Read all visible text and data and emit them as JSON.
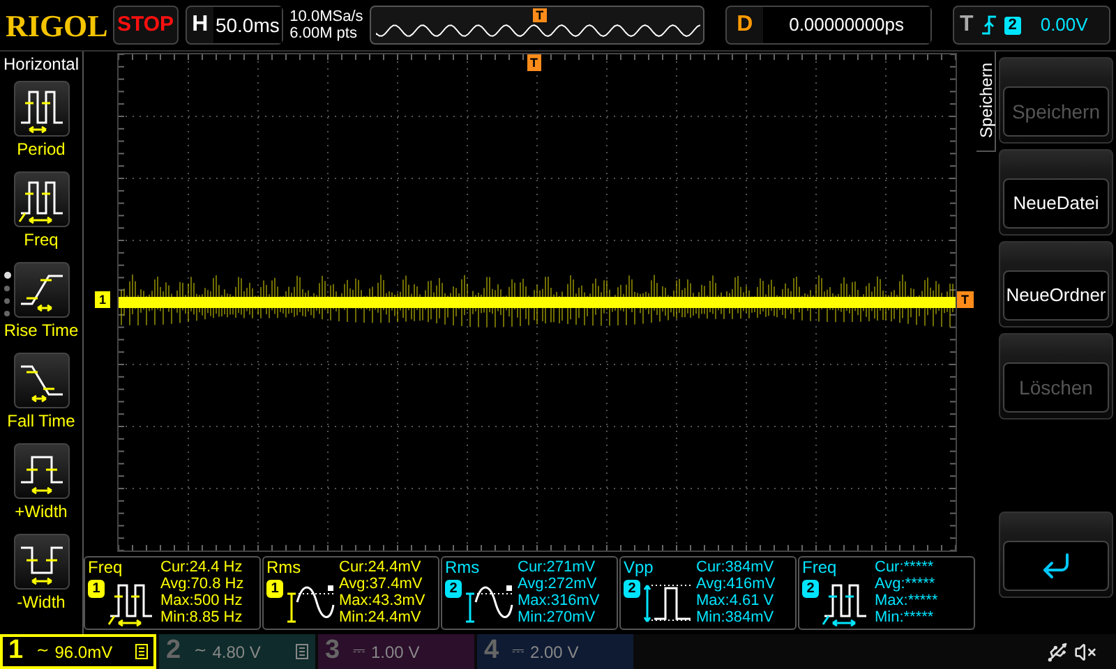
{
  "logo": "RIGOL",
  "run_state": "STOP",
  "timebase": {
    "label": "H",
    "value": "50.0ms"
  },
  "acquisition": {
    "sample_rate": "10.0MSa/s",
    "memory_depth": "6.00M pts"
  },
  "memory_strip": {
    "trigger_marker": "T"
  },
  "delay": {
    "label": "D",
    "value": "0.00000000ps"
  },
  "trigger": {
    "label": "T",
    "source": "2",
    "level": "0.00V"
  },
  "left_menu": {
    "title": "Horizontal",
    "items": [
      {
        "label": "Period",
        "kind": "period"
      },
      {
        "label": "Freq",
        "kind": "freq"
      },
      {
        "label": "Rise Time",
        "kind": "rise"
      },
      {
        "label": "Fall Time",
        "kind": "fall"
      },
      {
        "label": "+Width",
        "kind": "pwidth"
      },
      {
        "label": "-Width",
        "kind": "nwidth"
      }
    ],
    "pages": [
      {
        "selected": true
      },
      {
        "selected": false
      },
      {
        "selected": false
      },
      {
        "selected": false
      }
    ]
  },
  "waveform": {
    "trigger_position": "T",
    "channel_marker": "1",
    "trigger_level_marker": "T"
  },
  "side_menu": {
    "title": "Speichern",
    "items": [
      {
        "label": "Speichern",
        "disabled": true
      },
      {
        "label": "NeueDatei",
        "disabled": false
      },
      {
        "label": "NeueOrdner",
        "disabled": false
      },
      {
        "label": "Löschen",
        "disabled": true
      }
    ]
  },
  "measurements": [
    {
      "name": "Freq",
      "channel": "1",
      "kind": "freq",
      "color": "#ffff00",
      "lines": [
        "Cur:24.4 Hz",
        "Avg:70.8 Hz",
        "Max:500 Hz",
        "Min:8.85 Hz"
      ]
    },
    {
      "name": "Rms",
      "channel": "1",
      "kind": "rms",
      "color": "#ffff00",
      "lines": [
        "Cur:24.4mV",
        "Avg:37.4mV",
        "Max:43.3mV",
        "Min:24.4mV"
      ]
    },
    {
      "name": "Rms",
      "channel": "2",
      "kind": "rms",
      "color": "#00e5ff",
      "lines": [
        "Cur:271mV",
        "Avg:272mV",
        "Max:316mV",
        "Min:270mV"
      ]
    },
    {
      "name": "Vpp",
      "channel": "2",
      "kind": "vpp",
      "color": "#00e5ff",
      "lines": [
        "Cur:384mV",
        "Avg:416mV",
        "Max:4.61 V",
        "Min:384mV"
      ]
    },
    {
      "name": "Freq",
      "channel": "2",
      "kind": "freq",
      "color": "#00e5ff",
      "lines": [
        "Cur:*****",
        "Avg:*****",
        "Max:*****",
        "Min:*****"
      ]
    }
  ],
  "channels": [
    {
      "number": "1",
      "coupling": "~",
      "scale": "96.0mV",
      "bandwidth_limit": true,
      "active": true,
      "color": "#ffff00"
    },
    {
      "number": "2",
      "coupling": "~",
      "scale": "4.80 V",
      "bandwidth_limit": true,
      "active": false,
      "color": "#0f2b2b"
    },
    {
      "number": "3",
      "coupling": "⎓",
      "scale": "1.00 V",
      "bandwidth_limit": false,
      "active": false,
      "color": "#2b0f2b"
    },
    {
      "number": "4",
      "coupling": "⎓",
      "scale": "2.00 V",
      "bandwidth_limit": false,
      "active": false,
      "color": "#0f1b33"
    }
  ]
}
